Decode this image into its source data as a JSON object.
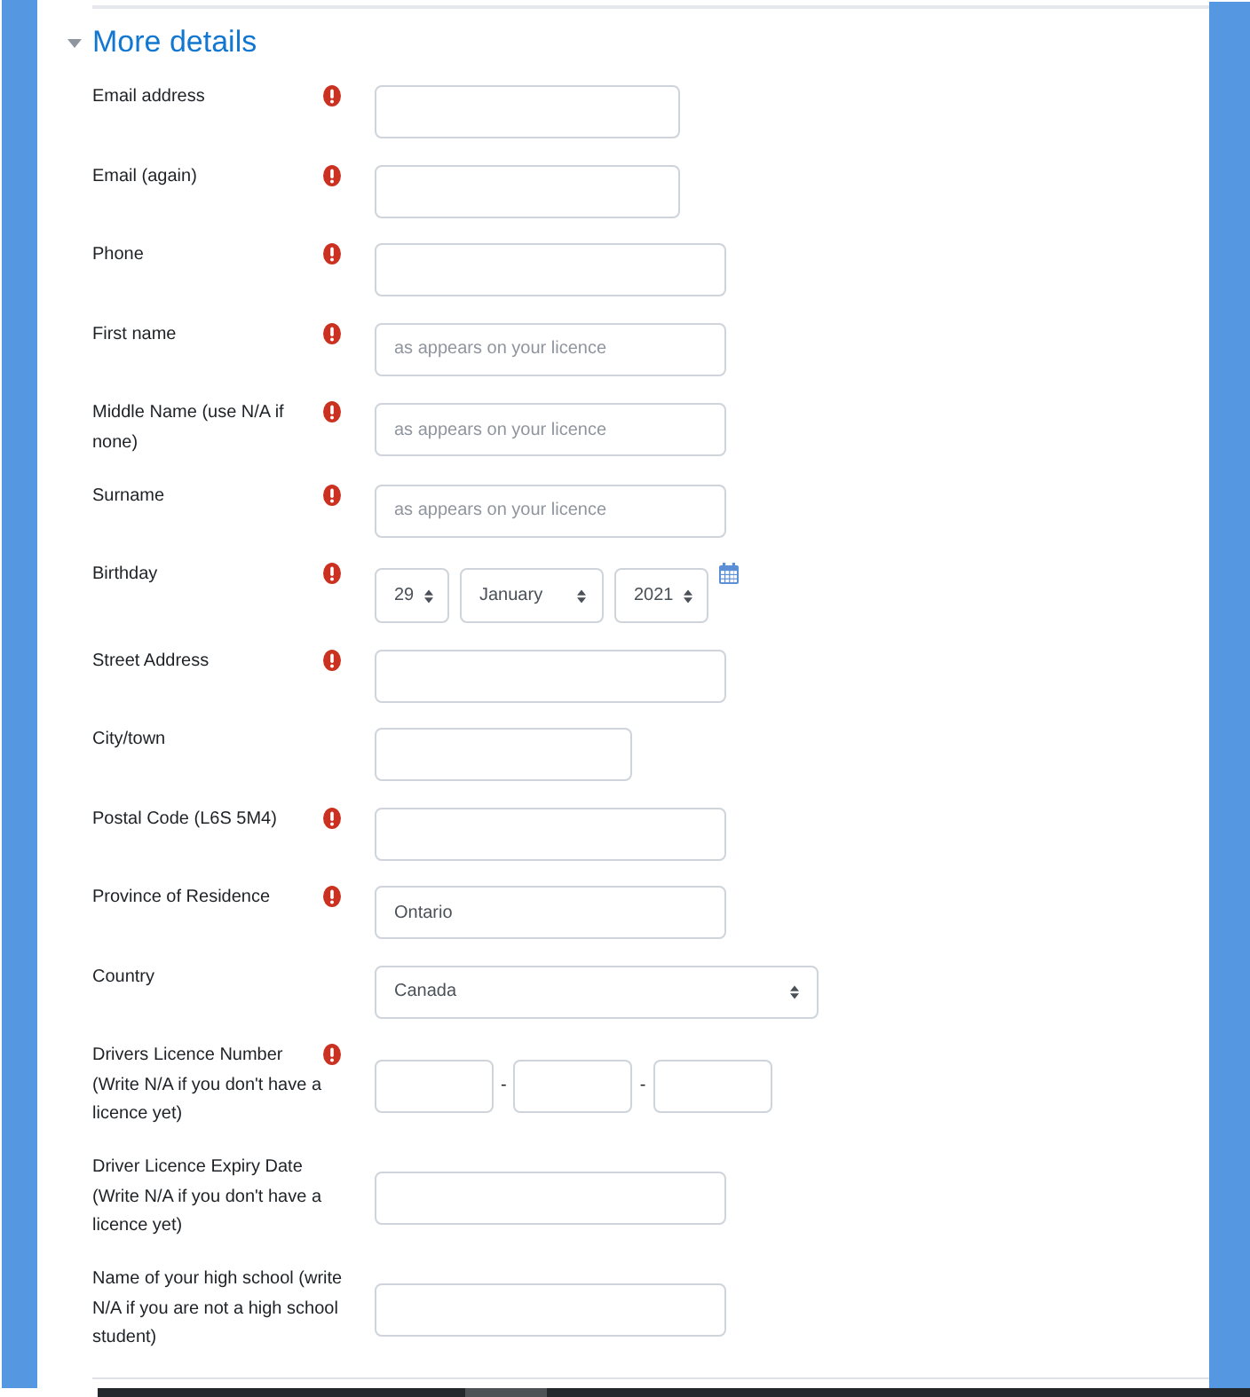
{
  "section": {
    "title": "More details",
    "expanded": true,
    "fields": [
      {
        "kind": "text",
        "label": "Email address",
        "required": true
      },
      {
        "kind": "text",
        "label": "Email (again)",
        "required": true
      },
      {
        "kind": "text",
        "label": "Phone",
        "required": true
      },
      {
        "kind": "text",
        "label": "First name",
        "required": true,
        "placeholder": "as appears on your licence"
      },
      {
        "kind": "text",
        "label": "Middle Name (use N/A if none)",
        "required": true,
        "placeholder": "as appears on your licence"
      },
      {
        "kind": "text",
        "label": "Surname",
        "required": true,
        "placeholder": "as appears on your licence"
      },
      {
        "kind": "date",
        "label": "Birthday",
        "required": true,
        "day": "29",
        "month": "January",
        "year": "2021"
      },
      {
        "kind": "text",
        "label": "Street Address",
        "required": true
      },
      {
        "kind": "text",
        "label": "City/town",
        "required": false
      },
      {
        "kind": "text",
        "label": "Postal Code (L6S 5M4)",
        "required": true
      },
      {
        "kind": "text",
        "label": "Province of Residence",
        "required": true,
        "value": "Ontario"
      },
      {
        "kind": "select",
        "label": "Country",
        "required": false,
        "value": "Canada"
      },
      {
        "kind": "split",
        "label": "Drivers Licence Number (Write N/A if you don't have a licence yet)",
        "required": true,
        "separators": [
          "-",
          "-"
        ]
      },
      {
        "kind": "text",
        "label": "Driver Licence Expiry Date (Write N/A if you don't have a licence yet)",
        "required": false
      },
      {
        "kind": "text",
        "label": "Name of your high school (write N/A if you are not a high school student)",
        "required": false
      }
    ]
  }
}
